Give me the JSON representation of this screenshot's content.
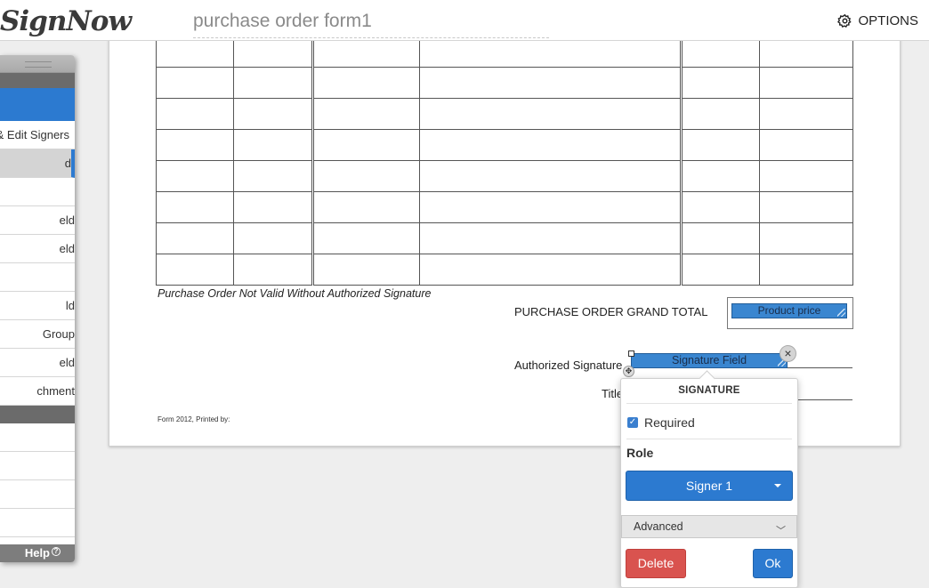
{
  "header": {
    "logo": "SignNow",
    "doc_title": "purchase order form1",
    "options_label": "OPTIONS"
  },
  "document": {
    "note": "Purchase Order Not Valid Without Authorized Signature",
    "grand_total_label": "PURCHASE ORDER GRAND TOTAL",
    "product_price_field": "Product price",
    "authorized_signature_label": "Authorized Signature",
    "title_label": "Title",
    "footer": "Form 2012, Printed by:",
    "signature_field": "Signature Field"
  },
  "popup": {
    "header": "SIGNATURE",
    "required_label": "Required",
    "required_checked": true,
    "role_label": "Role",
    "role_value": "Signer 1",
    "advanced_label": "Advanced",
    "delete_label": "Delete",
    "ok_label": "Ok"
  },
  "left_panel": {
    "items": [
      "& Edit Signers",
      "d",
      "",
      "eld",
      "eld",
      "",
      "ld",
      "Group",
      "eld",
      "chment"
    ],
    "help_label": "Help"
  },
  "colors": {
    "accent": "#2c7ad0",
    "field": "#3a86d0",
    "danger": "#d9534f"
  }
}
